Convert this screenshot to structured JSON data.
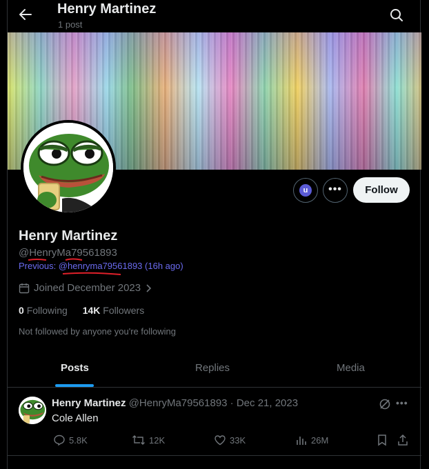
{
  "header": {
    "name": "Henry Martinez",
    "post_count": "1 post"
  },
  "profile": {
    "name": "Henry Martinez",
    "handle": "@HenryMa79561893",
    "previous": "Previous: @henryma79561893 (16h ago)",
    "joined": "Joined December 2023",
    "following_count": "0",
    "following_label": "Following",
    "followers_count": "14K",
    "followers_label": "Followers",
    "not_followed": "Not followed by anyone you're following",
    "follow_label": "Follow",
    "u_badge": "u"
  },
  "tabs": [
    {
      "label": "Posts",
      "active": true
    },
    {
      "label": "Replies",
      "active": false
    },
    {
      "label": "Media",
      "active": false
    }
  ],
  "post": {
    "author": "Henry Martinez",
    "meta": "@HenryMa79561893 · Dec 21, 2023",
    "text": "Cole Allen",
    "replies": "5.8K",
    "reposts": "12K",
    "likes": "33K",
    "views": "26M"
  },
  "icons": [
    "back-arrow-icon",
    "search-icon",
    "calendar-icon",
    "chevron-right-icon",
    "more-icon",
    "grok-icon",
    "reply-icon",
    "repost-icon",
    "like-icon",
    "views-icon",
    "bookmark-icon",
    "share-icon"
  ],
  "colors": {
    "accent": "#1d9bf0",
    "previous_link": "#6b6bf0",
    "annotation": "#e0202a"
  }
}
